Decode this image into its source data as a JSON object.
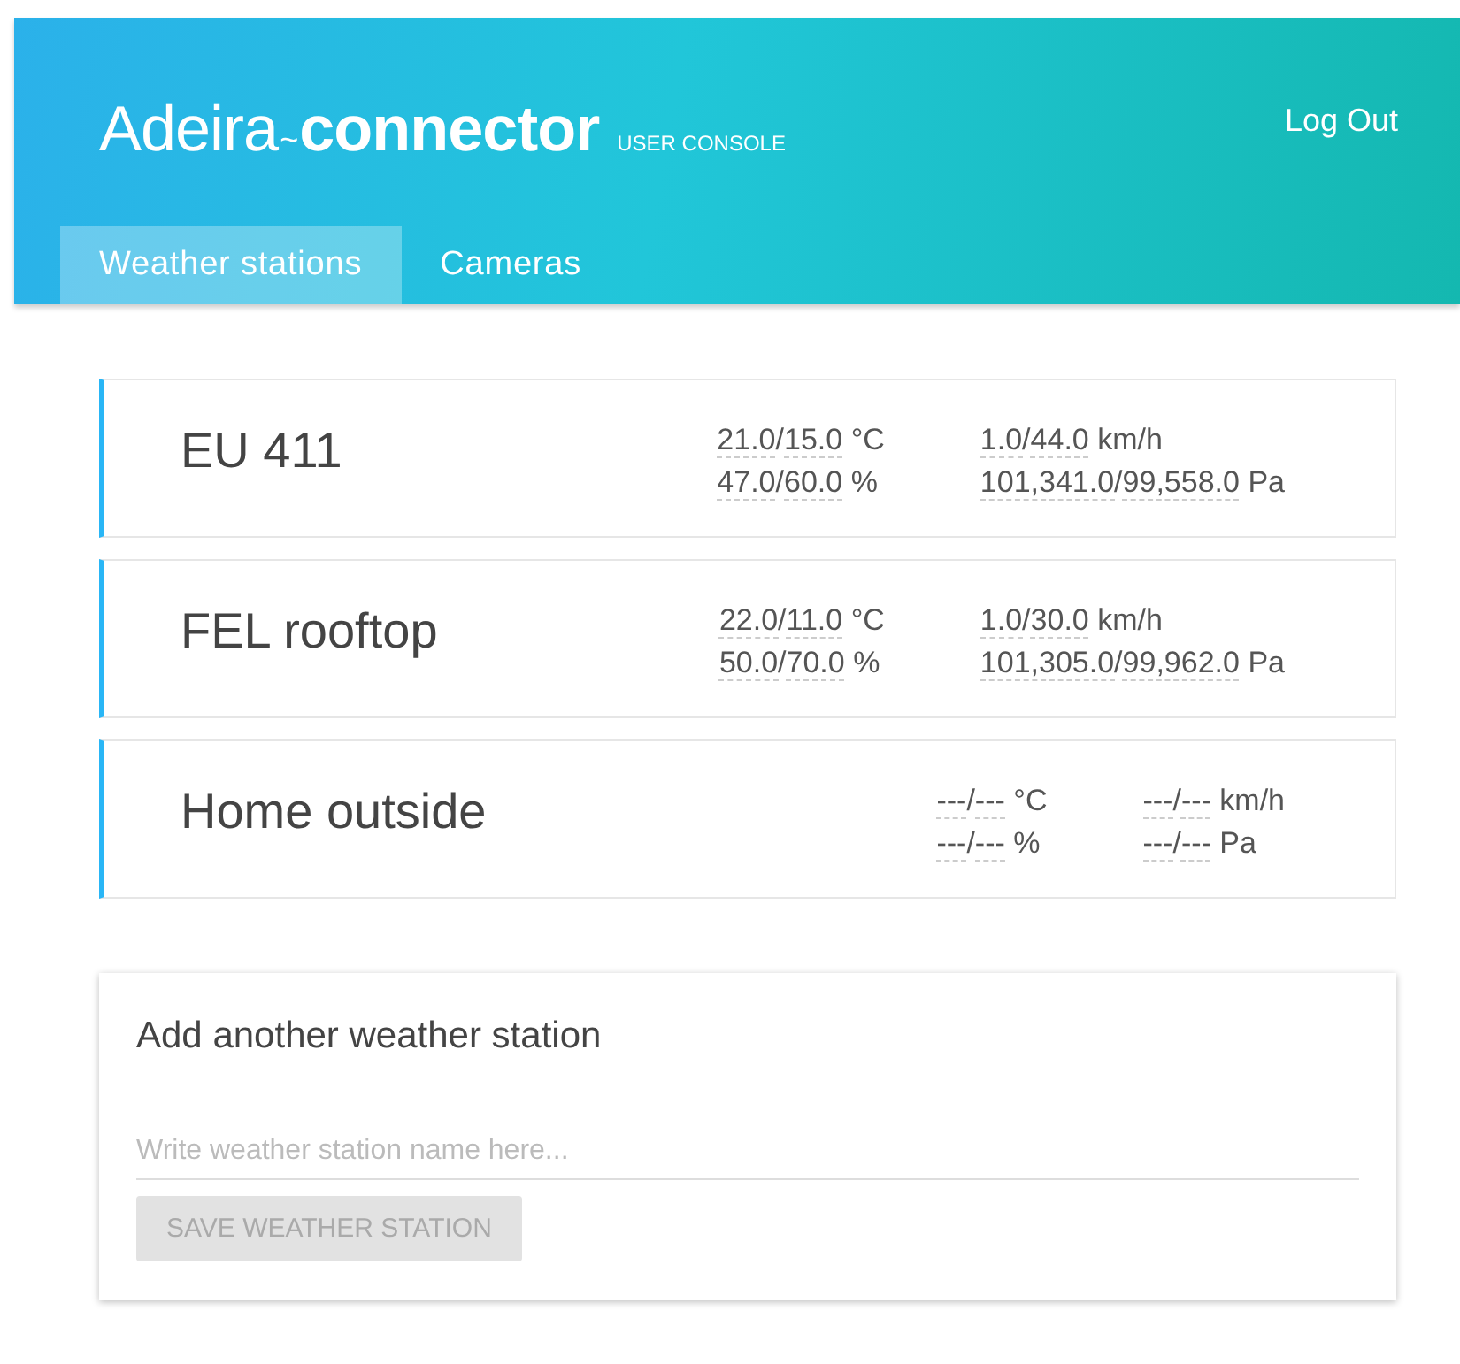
{
  "header": {
    "logo": {
      "light": "Adeira",
      "joiner": "~",
      "bold": "connector"
    },
    "subtitle": "USER CONSOLE",
    "logout": "Log Out"
  },
  "tabs": [
    {
      "label": "Weather stations",
      "selected": true
    },
    {
      "label": "Cameras",
      "selected": false
    }
  ],
  "stations": [
    {
      "name": "EU 411",
      "readings": [
        [
          {
            "values": [
              "21.0",
              "15.0"
            ],
            "separator": "/",
            "unit": "°C"
          },
          {
            "values": [
              "47.0",
              "60.0"
            ],
            "separator": "/",
            "unit": "%"
          }
        ],
        [
          {
            "values": [
              "1.0",
              "44.0"
            ],
            "separator": "/",
            "unit": "km/h"
          },
          {
            "values": [
              "101,341.0",
              "99,558.0"
            ],
            "separator": "/",
            "unit": "Pa"
          }
        ]
      ]
    },
    {
      "name": "FEL rooftop",
      "readings": [
        [
          {
            "values": [
              "22.0",
              "11.0"
            ],
            "separator": "/",
            "unit": "°C"
          },
          {
            "values": [
              "50.0",
              "70.0"
            ],
            "separator": "/",
            "unit": "%"
          }
        ],
        [
          {
            "values": [
              "1.0",
              "30.0"
            ],
            "separator": "/",
            "unit": "km/h"
          },
          {
            "values": [
              "101,305.0",
              "99,962.0"
            ],
            "separator": "/",
            "unit": "Pa"
          }
        ]
      ]
    },
    {
      "name": "Home outside",
      "readings": [
        [
          {
            "values": [
              "---",
              "---"
            ],
            "separator": "/",
            "unit": "°C"
          },
          {
            "values": [
              "---",
              "---"
            ],
            "separator": "/",
            "unit": "%"
          }
        ],
        [
          {
            "values": [
              "---",
              "---"
            ],
            "separator": "/",
            "unit": "km/h"
          },
          {
            "values": [
              "---",
              "---"
            ],
            "separator": "/",
            "unit": "Pa"
          }
        ]
      ]
    }
  ],
  "add_form": {
    "title": "Add another weather station",
    "placeholder": "Write weather station name here...",
    "button": {
      "label": "SAVE WEATHER STATION",
      "disabled": true
    }
  }
}
